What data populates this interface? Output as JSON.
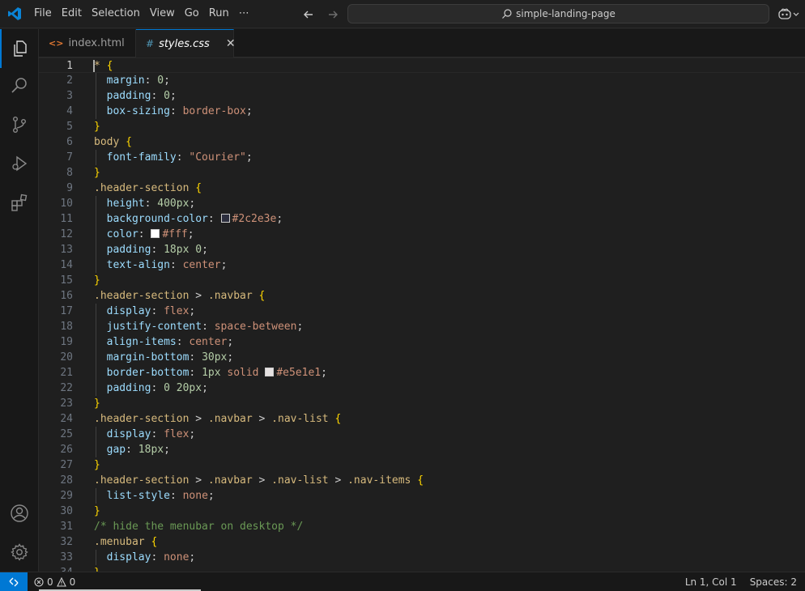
{
  "menu": [
    "File",
    "Edit",
    "Selection",
    "View",
    "Go",
    "Run",
    "⋯"
  ],
  "search": {
    "text": "simple-landing-page"
  },
  "tabs": [
    {
      "label": "index.html",
      "icon": "html-file-icon",
      "active": false
    },
    {
      "label": "styles.css",
      "icon": "css-file-icon",
      "active": true
    }
  ],
  "editor": {
    "current_line": 1,
    "lines": [
      [
        [
          "*",
          "sel"
        ],
        [
          " ",
          "punc"
        ],
        [
          "{",
          "brace"
        ]
      ],
      [
        [
          "  ",
          "punc"
        ],
        [
          "margin",
          "prop"
        ],
        [
          ": ",
          "punc"
        ],
        [
          "0",
          "num"
        ],
        [
          ";",
          "punc"
        ]
      ],
      [
        [
          "  ",
          "punc"
        ],
        [
          "padding",
          "prop"
        ],
        [
          ": ",
          "punc"
        ],
        [
          "0",
          "num"
        ],
        [
          ";",
          "punc"
        ]
      ],
      [
        [
          "  ",
          "punc"
        ],
        [
          "box-sizing",
          "prop"
        ],
        [
          ": ",
          "punc"
        ],
        [
          "border-box",
          "val"
        ],
        [
          ";",
          "punc"
        ]
      ],
      [
        [
          "}",
          "brace"
        ]
      ],
      [
        [
          "body",
          "tag"
        ],
        [
          " ",
          "punc"
        ],
        [
          "{",
          "brace"
        ]
      ],
      [
        [
          "  ",
          "punc"
        ],
        [
          "font-family",
          "prop"
        ],
        [
          ": ",
          "punc"
        ],
        [
          "\"Courier\"",
          "str"
        ],
        [
          ";",
          "punc"
        ]
      ],
      [
        [
          "}",
          "brace"
        ]
      ],
      [
        [
          ".header-section",
          "sel"
        ],
        [
          " ",
          "punc"
        ],
        [
          "{",
          "brace"
        ]
      ],
      [
        [
          "  ",
          "punc"
        ],
        [
          "height",
          "prop"
        ],
        [
          ": ",
          "punc"
        ],
        [
          "400px",
          "num"
        ],
        [
          ";",
          "punc"
        ]
      ],
      [
        [
          "  ",
          "punc"
        ],
        [
          "background-color",
          "prop"
        ],
        [
          ": ",
          "punc"
        ],
        [
          "#2c2e3e",
          "swatch"
        ],
        [
          "#2c2e3e",
          "val"
        ],
        [
          ";",
          "punc"
        ]
      ],
      [
        [
          "  ",
          "punc"
        ],
        [
          "color",
          "prop"
        ],
        [
          ": ",
          "punc"
        ],
        [
          "#ffffff",
          "swatch"
        ],
        [
          "#fff",
          "val"
        ],
        [
          ";",
          "punc"
        ]
      ],
      [
        [
          "  ",
          "punc"
        ],
        [
          "padding",
          "prop"
        ],
        [
          ": ",
          "punc"
        ],
        [
          "18px 0",
          "num"
        ],
        [
          ";",
          "punc"
        ]
      ],
      [
        [
          "  ",
          "punc"
        ],
        [
          "text-align",
          "prop"
        ],
        [
          ": ",
          "punc"
        ],
        [
          "center",
          "val"
        ],
        [
          ";",
          "punc"
        ]
      ],
      [
        [
          "}",
          "brace"
        ]
      ],
      [
        [
          ".header-section",
          "sel"
        ],
        [
          " > ",
          "punc"
        ],
        [
          ".navbar",
          "sel"
        ],
        [
          " ",
          "punc"
        ],
        [
          "{",
          "brace"
        ]
      ],
      [
        [
          "  ",
          "punc"
        ],
        [
          "display",
          "prop"
        ],
        [
          ": ",
          "punc"
        ],
        [
          "flex",
          "val"
        ],
        [
          ";",
          "punc"
        ]
      ],
      [
        [
          "  ",
          "punc"
        ],
        [
          "justify-content",
          "prop"
        ],
        [
          ": ",
          "punc"
        ],
        [
          "space-between",
          "val"
        ],
        [
          ";",
          "punc"
        ]
      ],
      [
        [
          "  ",
          "punc"
        ],
        [
          "align-items",
          "prop"
        ],
        [
          ": ",
          "punc"
        ],
        [
          "center",
          "val"
        ],
        [
          ";",
          "punc"
        ]
      ],
      [
        [
          "  ",
          "punc"
        ],
        [
          "margin-bottom",
          "prop"
        ],
        [
          ": ",
          "punc"
        ],
        [
          "30px",
          "num"
        ],
        [
          ";",
          "punc"
        ]
      ],
      [
        [
          "  ",
          "punc"
        ],
        [
          "border-bottom",
          "prop"
        ],
        [
          ": ",
          "punc"
        ],
        [
          "1px",
          "num"
        ],
        [
          " ",
          "punc"
        ],
        [
          "solid",
          "val"
        ],
        [
          " ",
          "punc"
        ],
        [
          "#e5e1e1",
          "swatch"
        ],
        [
          "#e5e1e1",
          "val"
        ],
        [
          ";",
          "punc"
        ]
      ],
      [
        [
          "  ",
          "punc"
        ],
        [
          "padding",
          "prop"
        ],
        [
          ": ",
          "punc"
        ],
        [
          "0 20px",
          "num"
        ],
        [
          ";",
          "punc"
        ]
      ],
      [
        [
          "}",
          "brace"
        ]
      ],
      [
        [
          ".header-section",
          "sel"
        ],
        [
          " > ",
          "punc"
        ],
        [
          ".navbar",
          "sel"
        ],
        [
          " > ",
          "punc"
        ],
        [
          ".nav-list",
          "sel"
        ],
        [
          " ",
          "punc"
        ],
        [
          "{",
          "brace"
        ]
      ],
      [
        [
          "  ",
          "punc"
        ],
        [
          "display",
          "prop"
        ],
        [
          ": ",
          "punc"
        ],
        [
          "flex",
          "val"
        ],
        [
          ";",
          "punc"
        ]
      ],
      [
        [
          "  ",
          "punc"
        ],
        [
          "gap",
          "prop"
        ],
        [
          ": ",
          "punc"
        ],
        [
          "18px",
          "num"
        ],
        [
          ";",
          "punc"
        ]
      ],
      [
        [
          "}",
          "brace"
        ]
      ],
      [
        [
          ".header-section",
          "sel"
        ],
        [
          " > ",
          "punc"
        ],
        [
          ".navbar",
          "sel"
        ],
        [
          " > ",
          "punc"
        ],
        [
          ".nav-list",
          "sel"
        ],
        [
          " > ",
          "punc"
        ],
        [
          ".nav-items",
          "sel"
        ],
        [
          " ",
          "punc"
        ],
        [
          "{",
          "brace"
        ]
      ],
      [
        [
          "  ",
          "punc"
        ],
        [
          "list-style",
          "prop"
        ],
        [
          ": ",
          "punc"
        ],
        [
          "none",
          "val"
        ],
        [
          ";",
          "punc"
        ]
      ],
      [
        [
          "}",
          "brace"
        ]
      ],
      [
        [
          "/* hide the menubar on desktop */",
          "comm"
        ]
      ],
      [
        [
          ".menubar",
          "sel"
        ],
        [
          " ",
          "punc"
        ],
        [
          "{",
          "brace"
        ]
      ],
      [
        [
          "  ",
          "punc"
        ],
        [
          "display",
          "prop"
        ],
        [
          ": ",
          "punc"
        ],
        [
          "none",
          "val"
        ],
        [
          ";",
          "punc"
        ]
      ],
      [
        [
          "}",
          "brace"
        ]
      ]
    ]
  },
  "status": {
    "errors": "0",
    "warnings": "0",
    "position": "Ln 1, Col 1",
    "spaces": "Spaces: 2"
  },
  "colors": {
    "accent": "#0078d4",
    "background": "#1f1f1f"
  }
}
